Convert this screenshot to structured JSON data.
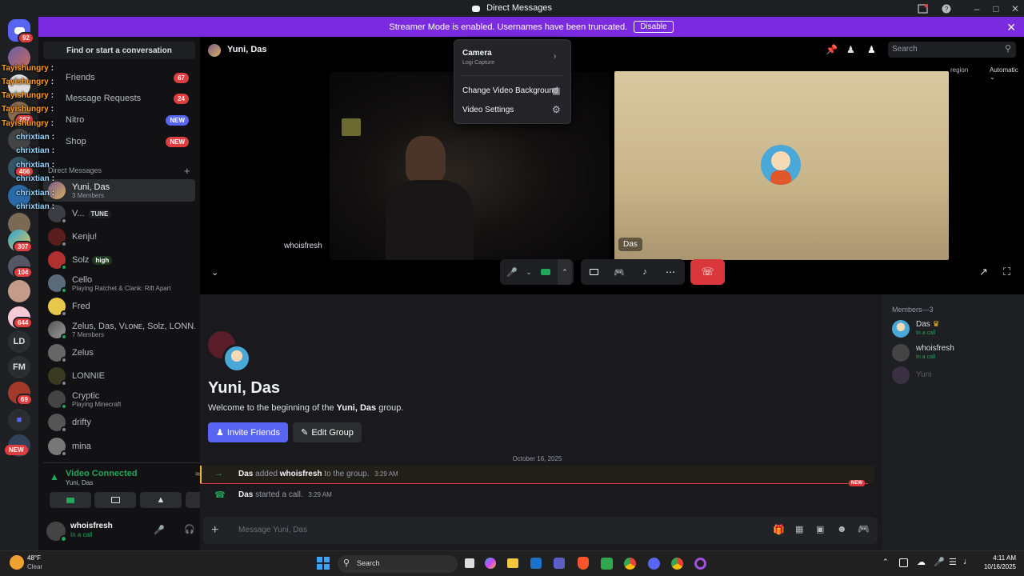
{
  "window": {
    "title": "Direct Messages"
  },
  "banner": {
    "text": "Streamer Mode is enabled. Usernames have been truncated.",
    "disable_label": "Disable"
  },
  "rail": {
    "badges": [
      "92",
      "267",
      "466",
      "307",
      "104",
      "644",
      "69"
    ],
    "labels": [
      "LD",
      "FM"
    ],
    "new_label": "NEW"
  },
  "sidebar": {
    "find": "Find or start a conversation",
    "nav": [
      {
        "label": "Friends",
        "count": "67"
      },
      {
        "label": "Message Requests",
        "count": "24"
      },
      {
        "label": "Nitro",
        "count": "NEW"
      },
      {
        "label": "Shop",
        "count": "NEW"
      }
    ],
    "dm_header": "Direct Messages",
    "dms": [
      {
        "name": "Yuni, Das",
        "sub": "3 Members"
      },
      {
        "name": "V...",
        "tag": "TUNE"
      },
      {
        "name": "Kenju!"
      },
      {
        "name": "Solz",
        "tag": "high"
      },
      {
        "name": "Cello",
        "sub": "Playing Ratchet & Clank: Rift Apart"
      },
      {
        "name": "Fred"
      },
      {
        "name": "Zelus, Das, Vʟᴏɴᴇ, Solz, LONN...",
        "sub": "7 Members"
      },
      {
        "name": "Zelus"
      },
      {
        "name": "LONNIE"
      },
      {
        "name": "Cryptic",
        "sub": "Playing Minecraft"
      },
      {
        "name": "drifty"
      },
      {
        "name": "mina"
      }
    ]
  },
  "overlay_chat": [
    {
      "user": "Tayishungry",
      "sep": ":"
    },
    {
      "user": "Tayishungry",
      "sep": ":"
    },
    {
      "user": "Tayishungry",
      "sep": ":"
    },
    {
      "user": "Tayishungry",
      "sep": ":"
    },
    {
      "user": "Tayishungry",
      "sep": ":"
    },
    {
      "user": "chrixtian",
      "sep": ":"
    },
    {
      "user": "chrixtian",
      "sep": ":"
    },
    {
      "user": "chrixtian",
      "sep": ":"
    },
    {
      "user": "chrixtian",
      "sep": ":"
    },
    {
      "user": "chrixtian",
      "sep": ":"
    },
    {
      "user": "chrixtian",
      "sep": ":"
    }
  ],
  "voice": {
    "status": "Video Connected",
    "channel": "Yuni, Das",
    "user": "whoisfresh",
    "user_status": "In a call"
  },
  "call": {
    "title": "Yuni, Das",
    "stream1_label": "whoisfresh",
    "stream2_label": "Das",
    "region_label": "region",
    "region_value": "Automatic",
    "search_placeholder": "Search"
  },
  "camera_menu": {
    "camera_label": "Camera",
    "camera_device": "Logi Capture",
    "items": [
      "Change Video Background",
      "Video Settings"
    ]
  },
  "chat": {
    "group_title": "Yuni, Das",
    "welcome_prefix": "Welcome to the beginning of the ",
    "welcome_bold": "Yuni, Das",
    "welcome_suffix": " group.",
    "invite_label": "Invite Friends",
    "edit_label": "Edit Group",
    "date_divider": "October 16, 2025",
    "messages": [
      {
        "actor": "Das",
        "verb": " added ",
        "target": "whoisfresh",
        "rest": " to the group.",
        "time": "3:29 AM"
      },
      {
        "actor": "Das",
        "verb": " started a call.",
        "target": "",
        "rest": "",
        "time": "3:29 AM"
      }
    ],
    "new_label": "NEW",
    "composer_placeholder": "Message Yuni, Das"
  },
  "members": {
    "header": "Members—3",
    "list": [
      {
        "name": "Das",
        "status": "In a call"
      },
      {
        "name": "whoisfresh",
        "status": "In a call"
      },
      {
        "name": "Yuni",
        "status": ""
      }
    ]
  },
  "taskbar": {
    "weather_temp": "48°F",
    "weather_desc": "Clear",
    "search": "Search",
    "time": "4:11 AM",
    "date": "10/16/2025"
  },
  "colors": {
    "accent": "#5865f2",
    "banner": "#7a2be0",
    "danger": "#da373c",
    "online": "#23a55a"
  }
}
